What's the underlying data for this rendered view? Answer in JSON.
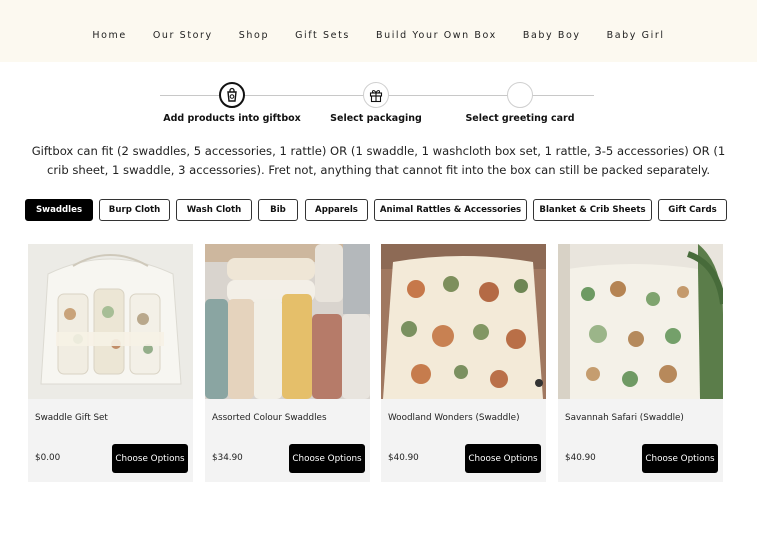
{
  "nav": {
    "links": [
      "Home",
      "Our Story",
      "Shop",
      "Gift Sets",
      "Build Your Own Box",
      "Baby Boy",
      "Baby Girl"
    ]
  },
  "steps": [
    {
      "label": "Add products into giftbox",
      "icon": "product-bag-icon",
      "state": "active"
    },
    {
      "label": "Select packaging",
      "icon": "gift-box-icon",
      "state": "pending"
    },
    {
      "label": "Select greeting card",
      "icon": "empty-circle-icon",
      "state": "pending"
    }
  ],
  "description": "Giftbox can fit (2 swaddles, 5 accessories, 1 rattle) OR (1 swaddle, 1 washcloth box set, 1 rattle, 3-5 accessories) OR (1 crib sheet, 1 swaddle, 3 accessories). Fret not, anything that cannot fit into the box can still be packed separately.",
  "filters": {
    "selected": "Swaddles",
    "items": [
      "Swaddles",
      "Burp Cloth",
      "Wash Cloth",
      "Bib",
      "Apparels",
      "Animal Rattles & Accessories",
      "Blanket & Crib Sheets",
      "Gift Cards"
    ]
  },
  "products": [
    {
      "name": "Swaddle Gift Set",
      "price": "$0.00",
      "button": "Choose Options"
    },
    {
      "name": "Assorted Colour Swaddles",
      "price": "$34.90",
      "button": "Choose Options"
    },
    {
      "name": "Woodland Wonders (Swaddle)",
      "price": "$40.90",
      "button": "Choose Options"
    },
    {
      "name": "Savannah Safari (Swaddle)",
      "price": "$40.90",
      "button": "Choose Options"
    }
  ],
  "colors": {
    "nav_bg": "#fcf9f0",
    "accent": "#000000",
    "card_bg": "#f3f3f3"
  }
}
